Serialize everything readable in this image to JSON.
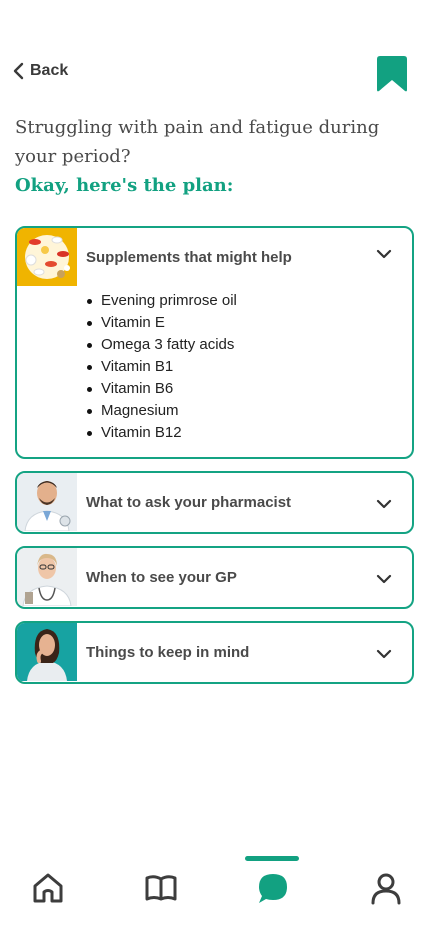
{
  "header": {
    "back_label": "Back",
    "back_icon": "chevron-left-icon",
    "bookmark_icon": "bookmark-icon"
  },
  "intro": {
    "question": "Struggling with pain and fatigue during your period?",
    "plan": "Okay, here's the plan:"
  },
  "cards": [
    {
      "title": "Supplements that might help",
      "expanded": true,
      "items": [
        "Evening primrose oil",
        "Vitamin E",
        "Omega 3 fatty acids",
        "Vitamin B1",
        "Vitamin B6",
        "Magnesium",
        "Vitamin B12"
      ]
    },
    {
      "title": "What to ask your pharmacist",
      "expanded": false
    },
    {
      "title": "When to see your GP",
      "expanded": false
    },
    {
      "title": "Things to keep in mind",
      "expanded": false
    }
  ],
  "tabbar": {
    "tabs": [
      {
        "icon": "home-icon",
        "active": false
      },
      {
        "icon": "book-icon",
        "active": false
      },
      {
        "icon": "chat-icon",
        "active": true
      },
      {
        "icon": "profile-icon",
        "active": false
      }
    ]
  },
  "colors": {
    "accent": "#12a181",
    "border": "#14a383",
    "text": "#4a4a4a",
    "icon": "#3d3d3d"
  }
}
